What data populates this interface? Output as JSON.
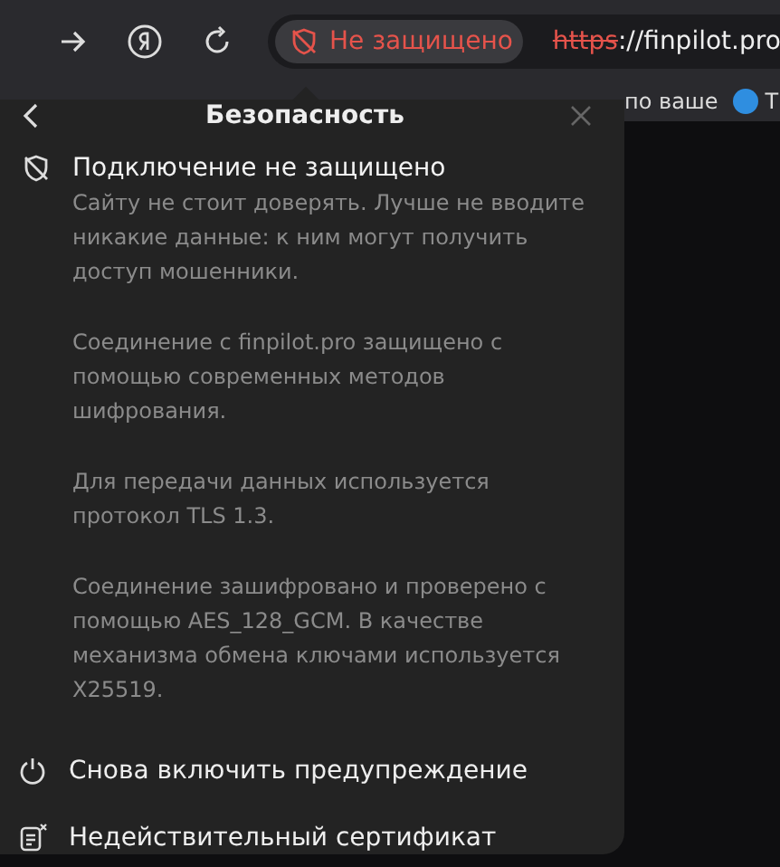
{
  "address_bar": {
    "security_label": "Не защищено",
    "url_scheme": "https",
    "url_rest": "://finpilot.pro"
  },
  "bookmarks": [
    {
      "kind": "site",
      "label": "по ваше"
    },
    {
      "kind": "telegram",
      "label": "Т"
    }
  ],
  "popup": {
    "title": "Безопасность",
    "connection": {
      "title": "Подключение не защищено",
      "description": "Сайту не стоит доверять. Лучше не вводите никакие данные: к ним могут получить доступ мошенники."
    },
    "details": [
      "Соединение с finpilot.pro защищено с помощью современных методов шифрования.",
      "Для передачи данных используется протокол TLS 1.3.",
      "Соединение зашифровано и проверено с помощью AES_128_GCM. В качестве механизма обмена ключами используется X25519."
    ],
    "actions": [
      {
        "kind": "power",
        "label": "Снова включить предупреждение"
      },
      {
        "kind": "certificate",
        "label": "Недействительный сертификат"
      }
    ]
  }
}
